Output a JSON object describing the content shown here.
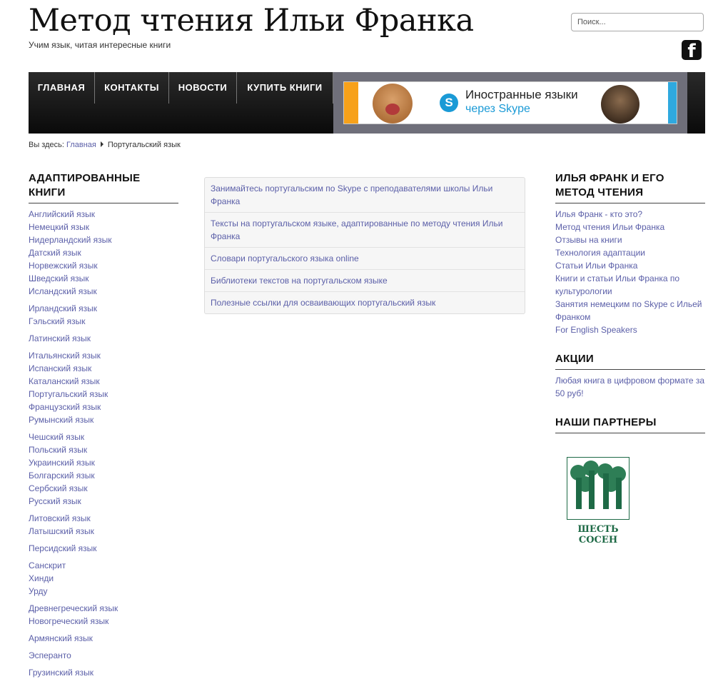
{
  "header": {
    "title": "Метод чтения Ильи Франка",
    "tagline": "Учим язык, читая интересные книги",
    "search_placeholder": "Поиск...",
    "social_icon": "facebook-icon"
  },
  "nav": {
    "items": [
      "ГЛАВНАЯ",
      "КОНТАКТЫ",
      "НОВОСТИ",
      "КУПИТЬ КНИГИ"
    ],
    "banner": {
      "line1": "Иностранные языки",
      "line2": "через Skype"
    }
  },
  "breadcrumb": {
    "prefix": "Вы здесь:",
    "home": "Главная",
    "current": "Португальский язык"
  },
  "left_sidebar": {
    "title": "АДАПТИРОВАННЫЕ КНИГИ",
    "groups": [
      [
        "Английский язык",
        "Немецкий язык",
        "Нидерландский язык",
        "Датский язык",
        "Норвежский язык",
        "Шведский язык",
        "Исландский язык"
      ],
      [
        "Ирландский язык",
        "Гэльский язык"
      ],
      [
        "Латинский язык"
      ],
      [
        "Итальянский язык",
        "Испанский язык",
        "Каталанский язык",
        "Португальский язык",
        "Французский язык",
        "Румынский язык"
      ],
      [
        "Чешский язык",
        "Польский язык",
        "Украинский язык",
        "Болгарский язык",
        "Сербский язык",
        "Русский язык"
      ],
      [
        "Литовский язык",
        "Латышский язык"
      ],
      [
        "Персидский язык"
      ],
      [
        "Санскрит",
        "Хинди",
        "Урду"
      ],
      [
        "Древнегреческий язык",
        "Новогреческий язык"
      ],
      [
        "Армянский язык"
      ],
      [
        "Эсперанто"
      ],
      [
        "Грузинский язык"
      ]
    ]
  },
  "content": {
    "links": [
      "Занимайтесь португальским по Skype с преподавателями школы Ильи Франка",
      "Тексты на португальском языке, адаптированные по методу чтения Ильи Франка",
      "Словари португальского языка online",
      "Библиотеки текстов на португальском языке",
      "Полезные ссылки для осваивающих португальский язык"
    ]
  },
  "right_sidebar": {
    "about": {
      "title": "ИЛЬЯ ФРАНК И ЕГО МЕТОД ЧТЕНИЯ",
      "links": [
        "Илья Франк - кто это?",
        "Метод чтения Ильи Франка",
        "Отзывы на книги",
        "Технология адаптации",
        "Статьи Ильи Франка",
        "Книги и статьи Ильи Франка по культурологии",
        "Занятия немецким по Skype с Ильей Франком",
        "For English Speakers"
      ]
    },
    "promo": {
      "title": "АКЦИИ",
      "links": [
        "Любая книга в цифровом формате за 50 руб!"
      ]
    },
    "partners": {
      "title": "НАШИ ПАРТНЕРЫ",
      "partner_name": "ШЕСТЬ СОСЕН"
    }
  }
}
